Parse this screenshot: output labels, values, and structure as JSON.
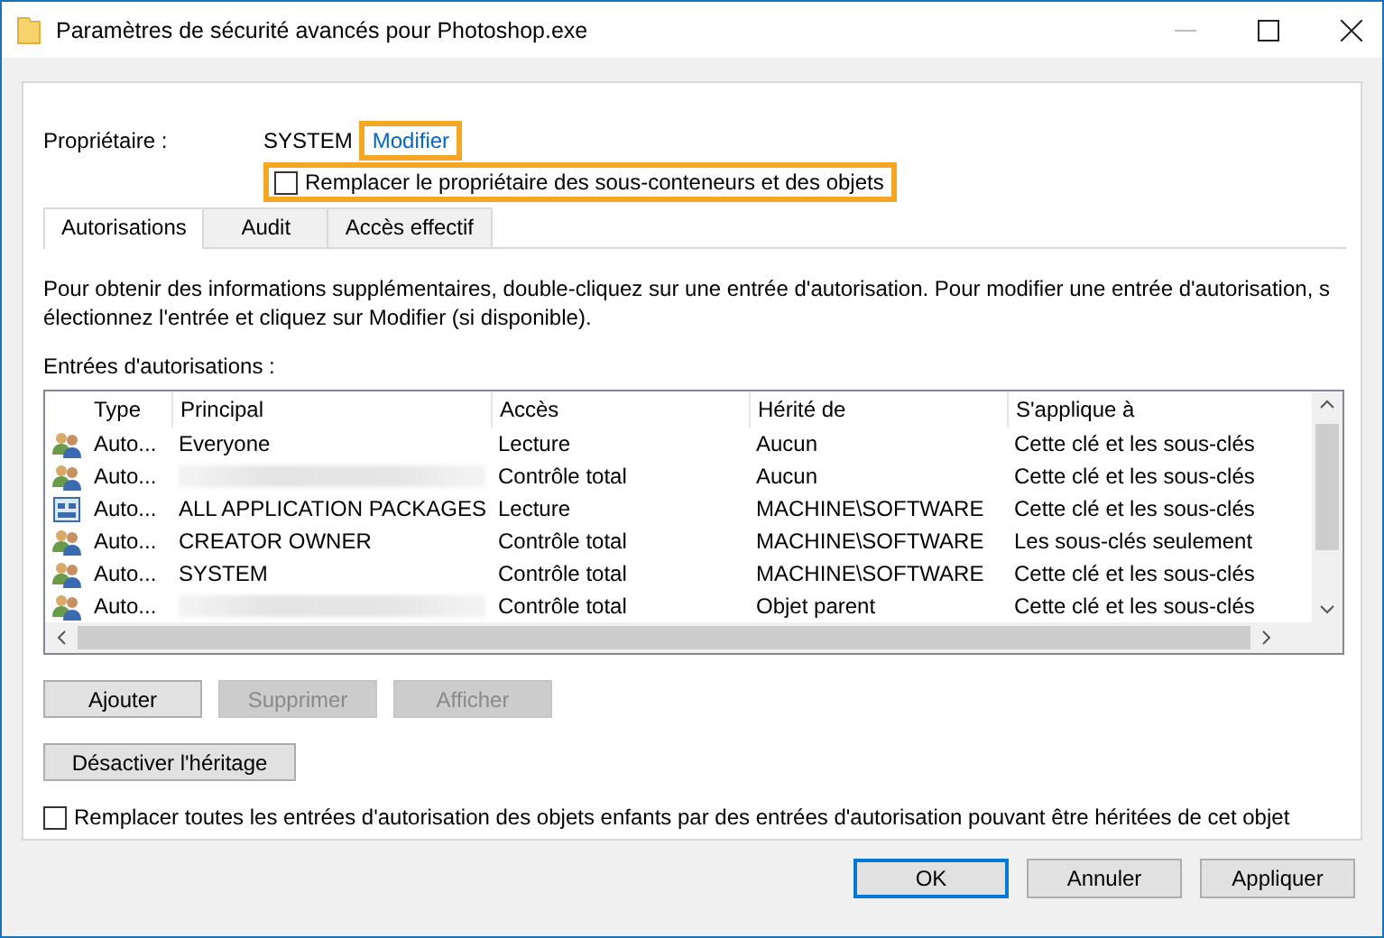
{
  "window": {
    "title": "Paramètres de sécurité avancés pour Photoshop.exe"
  },
  "owner": {
    "label": "Propriétaire :",
    "value": "SYSTEM",
    "modify_link": {
      "label": "Modifier",
      "highlighted": true
    },
    "replace_option": {
      "label": "Remplacer le propriétaire des sous-conteneurs et des objets",
      "checked": false,
      "highlighted": true
    }
  },
  "tabs": [
    {
      "label": "Autorisations",
      "selected": true
    },
    {
      "label": "Audit",
      "selected": false
    },
    {
      "label": "Accès effectif",
      "selected": false
    }
  ],
  "info_text": "Pour obtenir des informations supplémentaires, double-cliquez sur une entrée d'autorisation. Pour modifier une entrée d'autorisation, s électionnez l'entrée et cliquez sur Modifier (si disponible).",
  "entries_label": "Entrées d'autorisations :",
  "table": {
    "columns": [
      "Type",
      "Principal",
      "Accès",
      "Hérité de",
      "S'applique à"
    ],
    "rows": [
      {
        "kind": "users",
        "type": "Auto...",
        "principal": "Everyone",
        "blurred": false,
        "access": "Lecture",
        "inherited_from": "Aucun",
        "applies_to": "Cette clé et les sous-clés"
      },
      {
        "kind": "users",
        "type": "Auto...",
        "principal": "",
        "blurred": true,
        "access": "Contrôle total",
        "inherited_from": "Aucun",
        "applies_to": "Cette clé et les sous-clés"
      },
      {
        "kind": "package",
        "type": "Auto...",
        "principal": "ALL APPLICATION PACKAGES",
        "blurred": false,
        "access": "Lecture",
        "inherited_from": "MACHINE\\SOFTWARE",
        "applies_to": "Cette clé et les sous-clés"
      },
      {
        "kind": "users",
        "type": "Auto...",
        "principal": "CREATOR OWNER",
        "blurred": false,
        "access": "Contrôle total",
        "inherited_from": "MACHINE\\SOFTWARE",
        "applies_to": "Les sous-clés seulement"
      },
      {
        "kind": "users",
        "type": "Auto...",
        "principal": "SYSTEM",
        "blurred": false,
        "access": "Contrôle total",
        "inherited_from": "MACHINE\\SOFTWARE",
        "applies_to": "Cette clé et les sous-clés"
      },
      {
        "kind": "users",
        "type": "Auto...",
        "principal": "",
        "blurred": true,
        "access": "Contrôle total",
        "inherited_from": "Objet parent",
        "applies_to": "Cette clé et les sous-clés"
      }
    ]
  },
  "actions": [
    {
      "label": "Ajouter",
      "disabled": false
    },
    {
      "label": "Supprimer",
      "disabled": true
    },
    {
      "label": "Afficher",
      "disabled": true
    }
  ],
  "disable_inheritance": {
    "label": "Désactiver l'héritage"
  },
  "replace_children": {
    "label": "Remplacer toutes les entrées d'autorisation des objets enfants par des entrées d'autorisation pouvant être héritées de cet objet",
    "checked": false
  },
  "buttons": [
    {
      "label": "OK",
      "default": true
    },
    {
      "label": "Annuler",
      "default": false
    },
    {
      "label": "Appliquer",
      "default": false
    }
  ]
}
